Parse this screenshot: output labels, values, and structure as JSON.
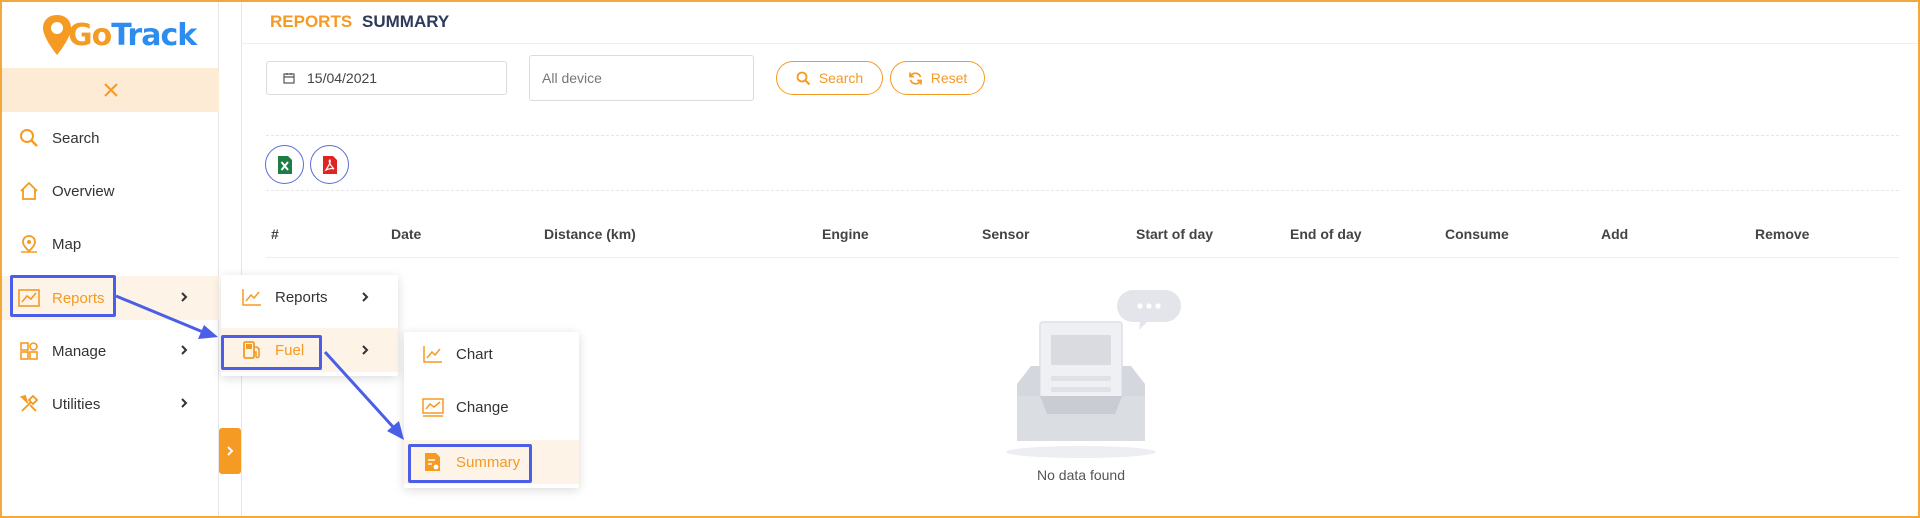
{
  "app": {
    "logo_go": "Go",
    "logo_track": "Track"
  },
  "sidebar": {
    "items": [
      {
        "label": "Search",
        "icon": "search-icon"
      },
      {
        "label": "Overview",
        "icon": "home-icon"
      },
      {
        "label": "Map",
        "icon": "map-pin-icon"
      },
      {
        "label": "Reports",
        "icon": "chart-icon"
      },
      {
        "label": "Manage",
        "icon": "grid-icon"
      },
      {
        "label": "Utilities",
        "icon": "tools-icon"
      }
    ]
  },
  "header": {
    "crumb1": "REPORTS",
    "crumb2": "SUMMARY"
  },
  "filters": {
    "date": "15/04/2021",
    "device_placeholder": "All device",
    "search_label": "Search",
    "reset_label": "Reset"
  },
  "table": {
    "columns": [
      "#",
      "Date",
      "Distance (km)",
      "Engine",
      "Sensor",
      "Start of day",
      "End of day",
      "Consume",
      "Add",
      "Remove"
    ],
    "empty_text": "No data found"
  },
  "submenu_reports": {
    "items": [
      {
        "label": "Reports"
      },
      {
        "label": "Fuel"
      }
    ]
  },
  "submenu_fuel": {
    "items": [
      {
        "label": "Chart"
      },
      {
        "label": "Change"
      },
      {
        "label": "Summary"
      }
    ]
  },
  "colors": {
    "accent": "#f59a23",
    "brand_blue": "#2d8cf0",
    "highlight": "#4a5ee8"
  }
}
